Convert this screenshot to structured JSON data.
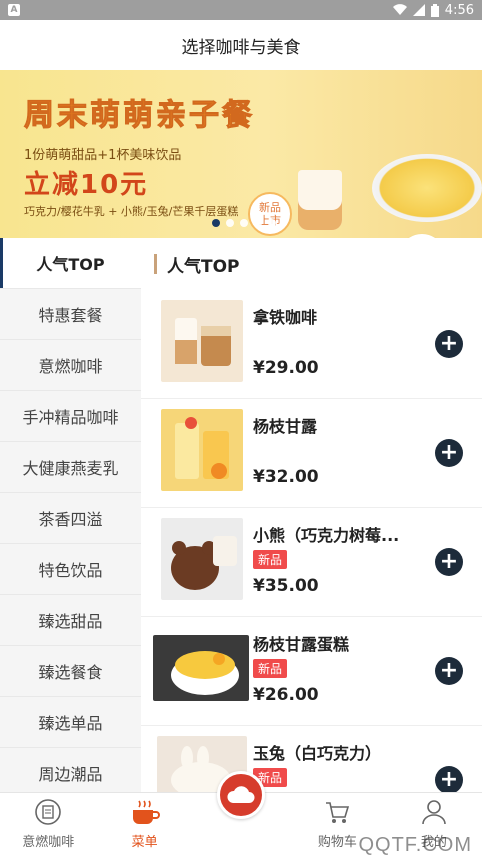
{
  "status_bar": {
    "app_icon": "A",
    "time": "4:56"
  },
  "header": {
    "title": "选择咖啡与美食"
  },
  "banner": {
    "title": "周末萌萌亲子餐",
    "line1": "1份萌萌甜品+1杯美味饮品",
    "discount": "立减10元",
    "line2": "巧克力/樱花牛乳 + 小熊/玉兔/芒果千层蛋糕",
    "badge": [
      "新品",
      "上市"
    ],
    "dots_total": 5,
    "dots_active_index": 0
  },
  "sidebar": {
    "items": [
      {
        "label": "人气TOP",
        "active": true
      },
      {
        "label": "特惠套餐",
        "active": false
      },
      {
        "label": "意燃咖啡",
        "active": false
      },
      {
        "label": "手冲精品咖啡",
        "active": false
      },
      {
        "label": "大健康燕麦乳",
        "active": false
      },
      {
        "label": "茶香四溢",
        "active": false
      },
      {
        "label": "特色饮品",
        "active": false
      },
      {
        "label": "臻选甜品",
        "active": false
      },
      {
        "label": "臻选餐食",
        "active": false
      },
      {
        "label": "臻选单品",
        "active": false
      },
      {
        "label": "周边潮品",
        "active": false
      }
    ]
  },
  "content": {
    "section_title": "人气TOP",
    "products": [
      {
        "name": "拿铁咖啡",
        "price": "¥29.00",
        "badge": ""
      },
      {
        "name": "杨枝甘露",
        "price": "¥32.00",
        "badge": ""
      },
      {
        "name": "小熊（巧克力树莓...",
        "price": "¥35.00",
        "badge": "新品"
      },
      {
        "name": "杨枝甘露蛋糕",
        "price": "¥26.00",
        "badge": "新品"
      },
      {
        "name": "玉兔（白巧克力）",
        "price": "",
        "badge": "新品"
      }
    ]
  },
  "tabbar": {
    "tabs": [
      {
        "label": "意燃咖啡",
        "icon": "store-icon",
        "active": false
      },
      {
        "label": "菜单",
        "icon": "coffee-cup-icon",
        "active": true
      },
      {
        "label": "",
        "icon": "cloud-logo-icon",
        "active": false
      },
      {
        "label": "购物车",
        "icon": "cart-icon",
        "active": false
      },
      {
        "label": "我的",
        "icon": "user-icon",
        "active": false
      }
    ]
  },
  "watermark": "QQTF.COM",
  "colors": {
    "accent": "#e2531c",
    "nav_dark": "#1d2b3a",
    "badge_red": "#f04b4b"
  }
}
